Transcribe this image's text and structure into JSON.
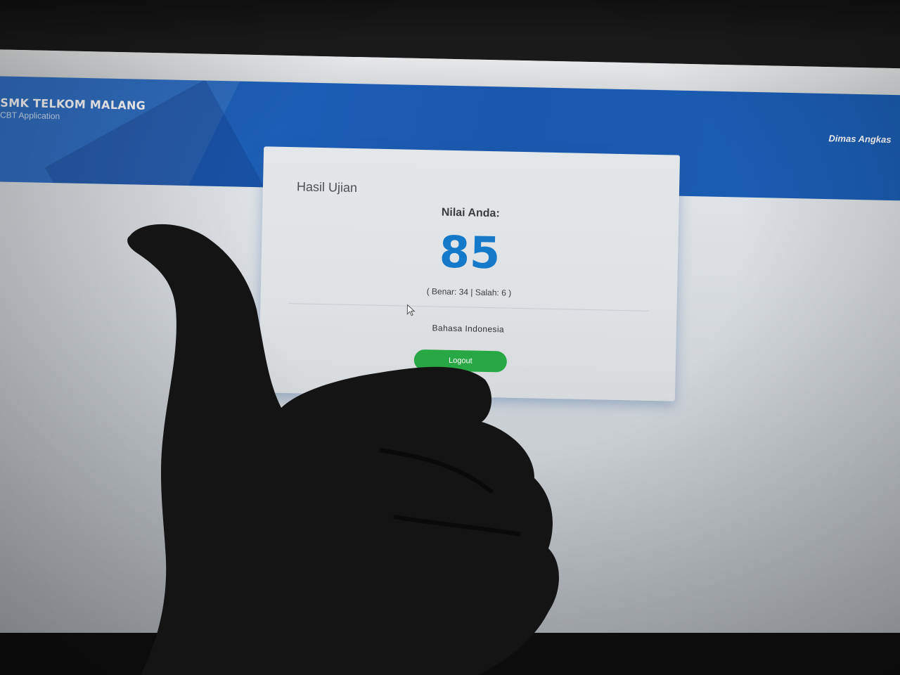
{
  "header": {
    "brand_title": "SMK TELKOM MALANG",
    "brand_subtitle": "CBT Application",
    "user_name": "Dimas Angkas"
  },
  "result_card": {
    "title": "Hasil Ujian",
    "score_label": "Nilai Anda:",
    "score": "85",
    "breakdown": "( Benar: 34 | Salah: 6 )",
    "subject": "Bahasa Indonesia",
    "logout_label": "Logout"
  },
  "colors": {
    "header_blue": "#1d5fb7",
    "score_blue": "#1479c8",
    "logout_green": "#28a745"
  },
  "icons": {
    "cursor": "mouse-pointer-icon"
  }
}
